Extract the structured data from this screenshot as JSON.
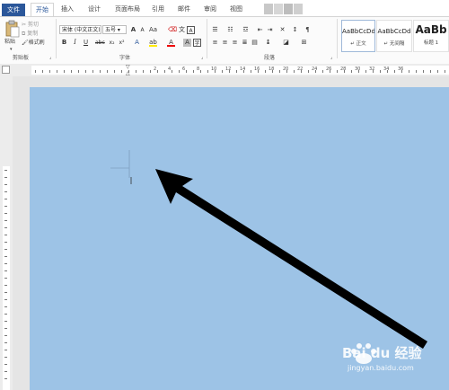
{
  "tabs": [
    {
      "label": "文件",
      "state": "file"
    },
    {
      "label": "开始",
      "state": "active"
    },
    {
      "label": "插入",
      "state": ""
    },
    {
      "label": "设计",
      "state": ""
    },
    {
      "label": "页面布局",
      "state": ""
    },
    {
      "label": "引用",
      "state": ""
    },
    {
      "label": "邮件",
      "state": ""
    },
    {
      "label": "审阅",
      "state": ""
    },
    {
      "label": "视图",
      "state": ""
    }
  ],
  "clipboard": {
    "paste_label": "粘贴",
    "cut_label": "剪切",
    "copy_label": "复制",
    "format_painter_label": "格式刷",
    "group_label": "剪贴板"
  },
  "font": {
    "font_name": "宋体 (中文正文)",
    "font_size": "五号",
    "group_label": "字体"
  },
  "paragraph": {
    "group_label": "段落"
  },
  "styles": [
    {
      "sample": "AaBbCcDd",
      "name": "↵ 正文",
      "selected": true
    },
    {
      "sample": "AaBbCcDd",
      "name": "↵ 无间隔",
      "selected": false
    },
    {
      "sample": "AaBb",
      "name": "标题 1",
      "selected": false
    }
  ],
  "ruler_numbers": [
    "2",
    "4",
    "6",
    "8",
    "10",
    "12",
    "14",
    "16",
    "18",
    "20",
    "22",
    "24",
    "26",
    "28",
    "30",
    "32",
    "34",
    "36"
  ],
  "colors": {
    "page": "#9dc3e6",
    "accent": "#2b579a",
    "arrow": "#000000"
  },
  "watermark": {
    "brand": "Bai du 经验",
    "url": "jingyan.baidu.com"
  }
}
